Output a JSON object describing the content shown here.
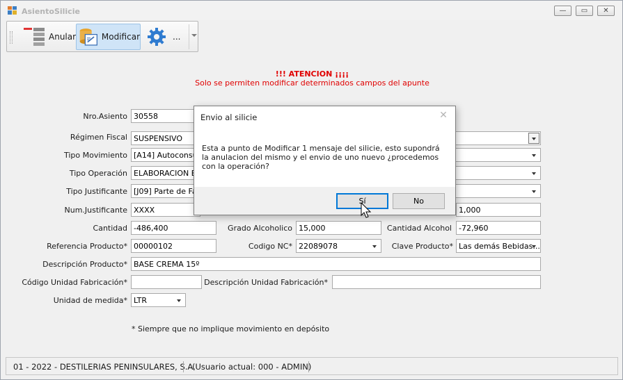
{
  "window": {
    "title": "AsientoSilicie",
    "controls": {
      "minimize": "—",
      "maximize": "▭",
      "close": "✕"
    }
  },
  "toolbar": {
    "anular_label": "Anular",
    "modificar_label": "Modificar",
    "more_label": "..."
  },
  "notice": {
    "title": "!!! ATENCION ¡¡¡¡",
    "subtitle": "Solo se permiten modificar determinados campos del apunte"
  },
  "form": {
    "nro_asiento_label": "Nro.Asiento",
    "nro_asiento_value": "30558",
    "regimen_fiscal_label": "Régimen Fiscal",
    "regimen_fiscal_value": "SUSPENSIVO",
    "tipo_movimiento_label": "Tipo Movimiento",
    "tipo_movimiento_value": "[A14] Autoconsum",
    "tipo_operacion_label": "Tipo Operación",
    "tipo_operacion_value": "ELABORACION EN",
    "tipo_justificante_label": "Tipo Justificante",
    "tipo_justificante_value": "[J09] Parte de Fab",
    "num_justificante_label": "Num.Justificante",
    "num_justificante_value": "XXXX",
    "hidden_right_value": "1,000",
    "cantidad_label": "Cantidad",
    "cantidad_value": "-486,400",
    "grado_alcoholico_label": "Grado Alcoholico",
    "grado_alcoholico_value": "15,000",
    "cantidad_alcohol_label": "Cantidad Alcohol",
    "cantidad_alcohol_value": "-72,960",
    "referencia_producto_label": "Referencia Producto*",
    "referencia_producto_value": "00000102",
    "codigo_nc_label": "Codigo NC*",
    "codigo_nc_value": "22089078",
    "clave_producto_label": "Clave Producto*",
    "clave_producto_value": "Las demás Bebidas...",
    "descripcion_producto_label": "Descripción Producto*",
    "descripcion_producto_value": "BASE CREMA 15º",
    "codigo_unidad_fab_label": "Código Unidad Fabricación*",
    "codigo_unidad_fab_value": "",
    "descripcion_unidad_fab_label": "Descripción Unidad Fabricación*",
    "descripcion_unidad_fab_value": "",
    "unidad_medida_label": "Unidad de medida*",
    "unidad_medida_value": "LTR"
  },
  "footnote": "* Siempre que no implique movimiento en depósito",
  "statusbar": {
    "company": "01 - 2022 - DESTILERIAS PENINSULARES, S.A.",
    "user": "(Usuario actual: 000 - ADMIN)"
  },
  "dialog": {
    "title": "Envio al silicie",
    "close": "✕",
    "message": "Esta a punto de Modificar 1 mensaje del silicie, esto supondrá la anulacion del mismo y el envio de uno nuevo ¿procedemos con la operación?",
    "yes_label": "Sí",
    "no_label": "No"
  },
  "colors": {
    "notice_red": "#e00000",
    "focus_blue": "#0078d7",
    "active_tool_bg": "#cfe4f7"
  }
}
